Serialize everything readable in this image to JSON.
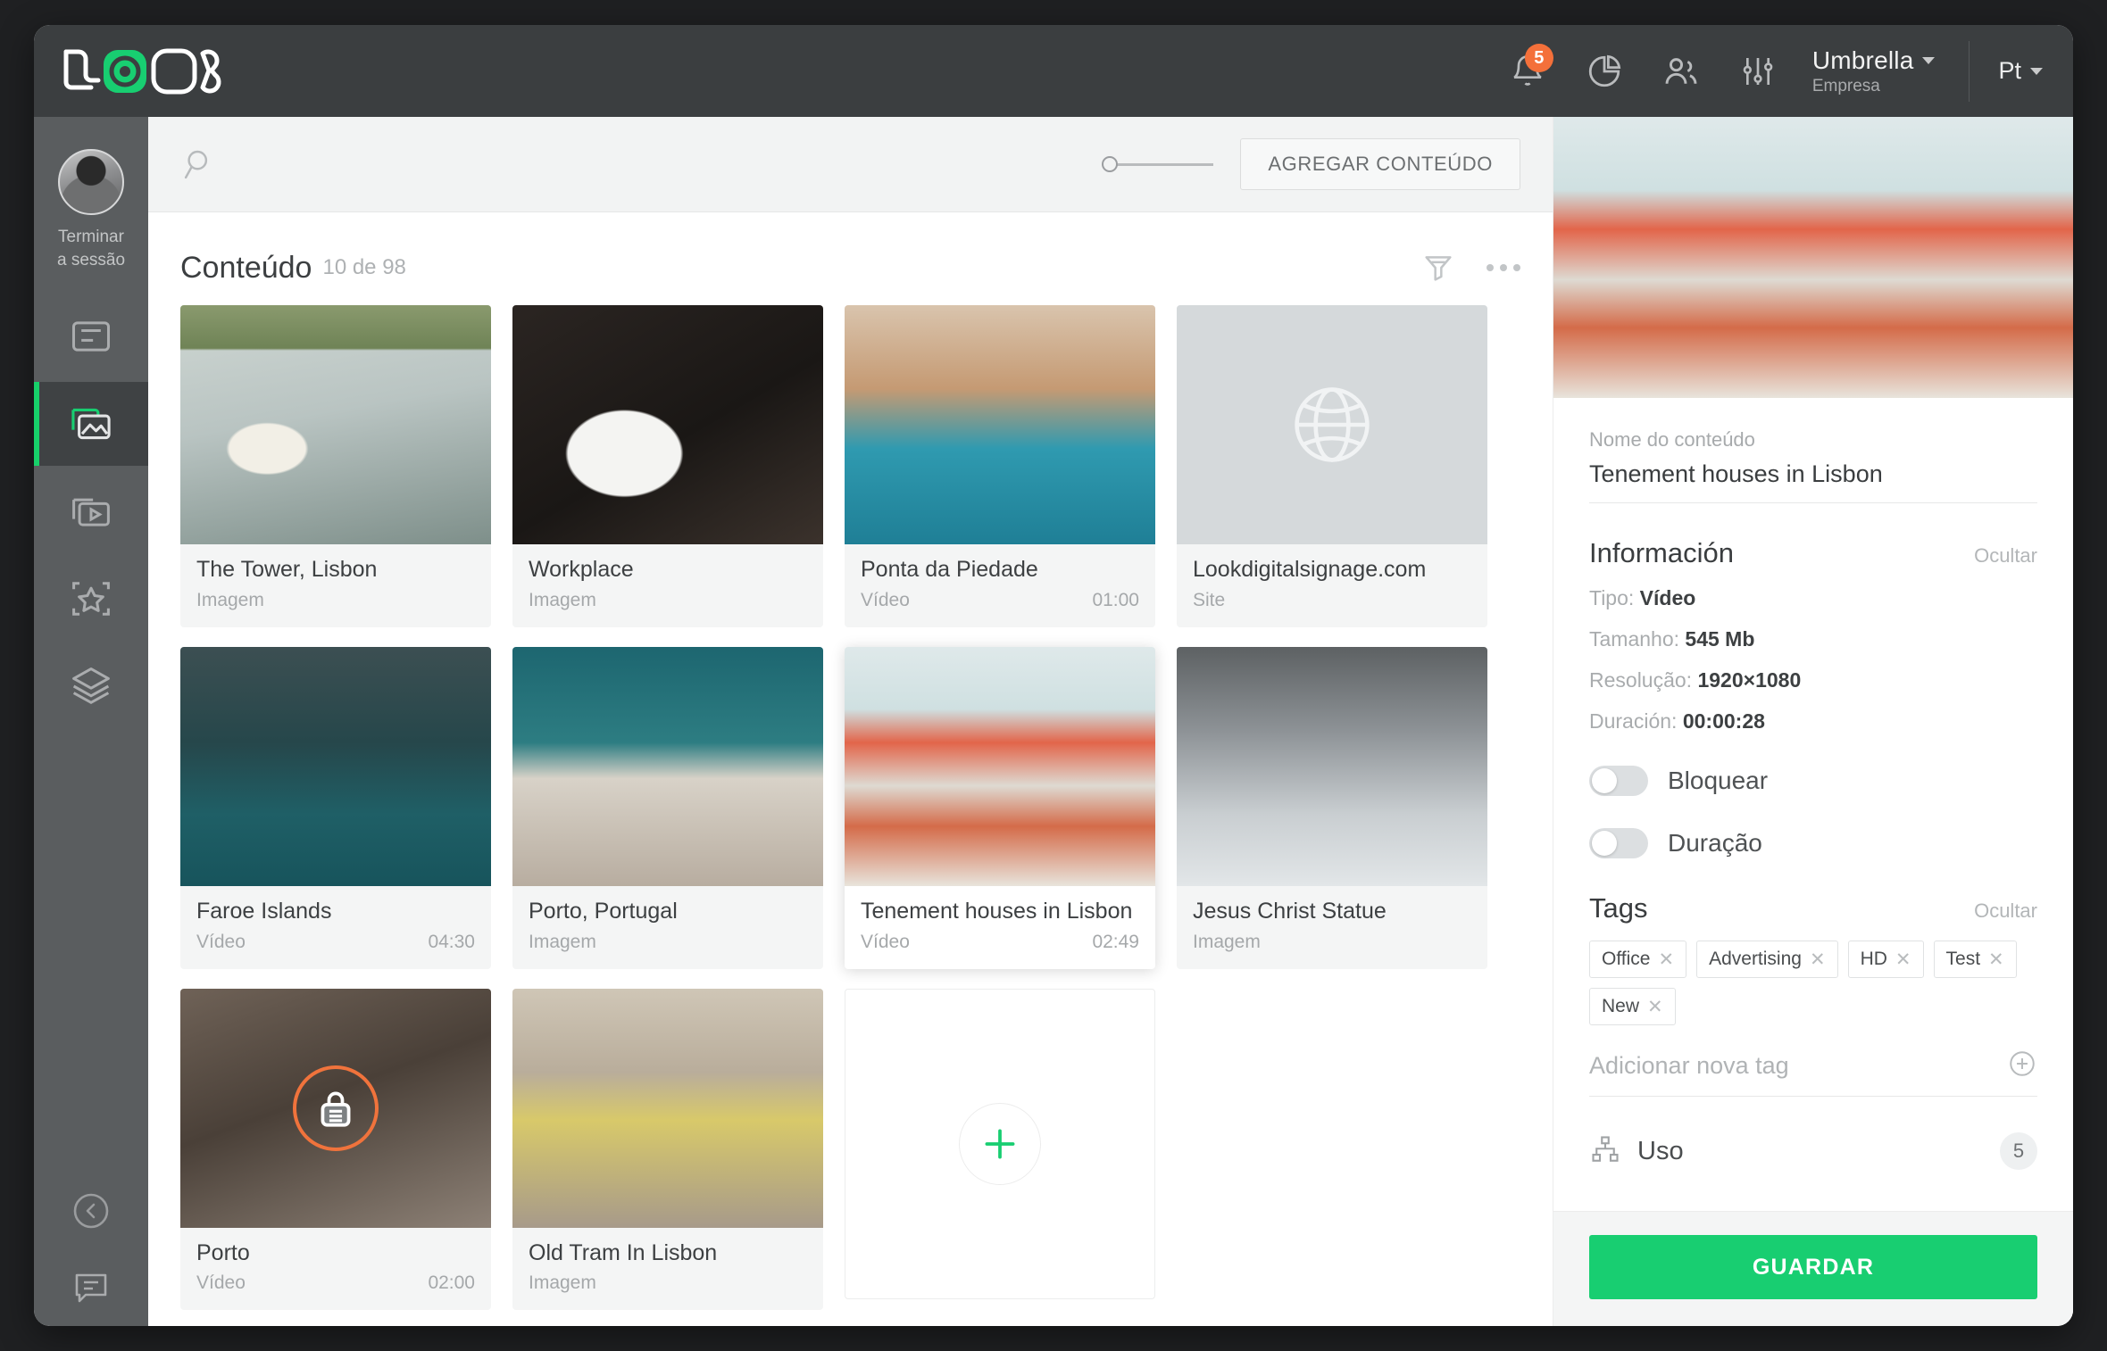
{
  "app": {
    "logo_text": "LOOK",
    "accent_green": "#18ce71",
    "badge_orange": "#f4703a",
    "header_bg": "#3b3e40",
    "sidebar_bg": "#5a5d5f"
  },
  "header": {
    "notifications_count": "5",
    "org_name": "Umbrella",
    "org_type": "Empresa",
    "language": "Pt",
    "icons": [
      "bell-icon",
      "pie-chart-icon",
      "users-icon",
      "sliders-icon"
    ]
  },
  "sidebar": {
    "logout_line1": "Terminar",
    "logout_line2": "a sessão",
    "items": [
      {
        "name": "screens",
        "active": false
      },
      {
        "name": "content",
        "active": true
      },
      {
        "name": "playlists",
        "active": false
      },
      {
        "name": "campaigns",
        "active": false
      },
      {
        "name": "layers",
        "active": false
      }
    ],
    "collapse_icon": "chevron-left-circle-icon",
    "chat_icon": "chat-bubble-icon"
  },
  "toolbar": {
    "search_placeholder": "",
    "search_value": "",
    "zoom_slider_value": 0,
    "add_content_label": "AGREGAR CONTEÚDO"
  },
  "content": {
    "title": "Conteúdo",
    "count_label": "10 de 98",
    "filter_icon": "funnel-filter-icon",
    "more_icon": "more-dots-icon",
    "add_card_label": "+",
    "cards": [
      {
        "title": "The Tower, Lisbon",
        "type": "Imagem",
        "duration": "",
        "kind": "image",
        "locked": false,
        "selected": false
      },
      {
        "title": "Workplace",
        "type": "Imagem",
        "duration": "",
        "kind": "image",
        "locked": false,
        "selected": false
      },
      {
        "title": "Ponta da Piedade",
        "type": "Vídeo",
        "duration": "01:00",
        "kind": "video",
        "locked": false,
        "selected": false
      },
      {
        "title": "Lookdigitalsignage.com",
        "type": "Site",
        "duration": "",
        "kind": "site",
        "locked": false,
        "selected": false
      },
      {
        "title": "Faroe Islands",
        "type": "Vídeo",
        "duration": "04:30",
        "kind": "video",
        "locked": false,
        "selected": false
      },
      {
        "title": "Porto, Portugal",
        "type": "Imagem",
        "duration": "",
        "kind": "image",
        "locked": false,
        "selected": false
      },
      {
        "title": "Tenement houses in Lisbon",
        "type": "Vídeo",
        "duration": "02:49",
        "kind": "video",
        "locked": false,
        "selected": true
      },
      {
        "title": "Jesus Christ Statue",
        "type": "Imagem",
        "duration": "",
        "kind": "image",
        "locked": false,
        "selected": false
      },
      {
        "title": "Porto",
        "type": "Vídeo",
        "duration": "02:00",
        "kind": "video",
        "locked": true,
        "selected": false
      },
      {
        "title": "Old Tram In Lisbon",
        "type": "Imagem",
        "duration": "",
        "kind": "image",
        "locked": false,
        "selected": false
      }
    ]
  },
  "panel": {
    "name_label": "Nome do conteúdo",
    "name_value": "Tenement houses in Lisbon",
    "info": {
      "title": "Información",
      "toggle_label": "Ocultar",
      "rows": [
        {
          "label": "Tipo:",
          "value": "Vídeo"
        },
        {
          "label": "Tamanho:",
          "value": "545 Mb"
        },
        {
          "label": "Resolução:",
          "value": "1920×1080"
        },
        {
          "label": "Duración:",
          "value": "00:00:28"
        }
      ]
    },
    "switches": [
      {
        "label": "Bloquear",
        "on": false
      },
      {
        "label": "Duração",
        "on": false
      }
    ],
    "tags": {
      "title": "Tags",
      "toggle_label": "Ocultar",
      "items": [
        "Office",
        "Advertising",
        "HD",
        "Test",
        "New"
      ],
      "new_tag_placeholder": "Adicionar nova tag",
      "new_tag_value": "",
      "add_icon": "plus-circle-icon"
    },
    "usage": {
      "icon": "sitemap-icon",
      "label": "Uso",
      "count": "5"
    },
    "save_label": "GUARDAR"
  }
}
